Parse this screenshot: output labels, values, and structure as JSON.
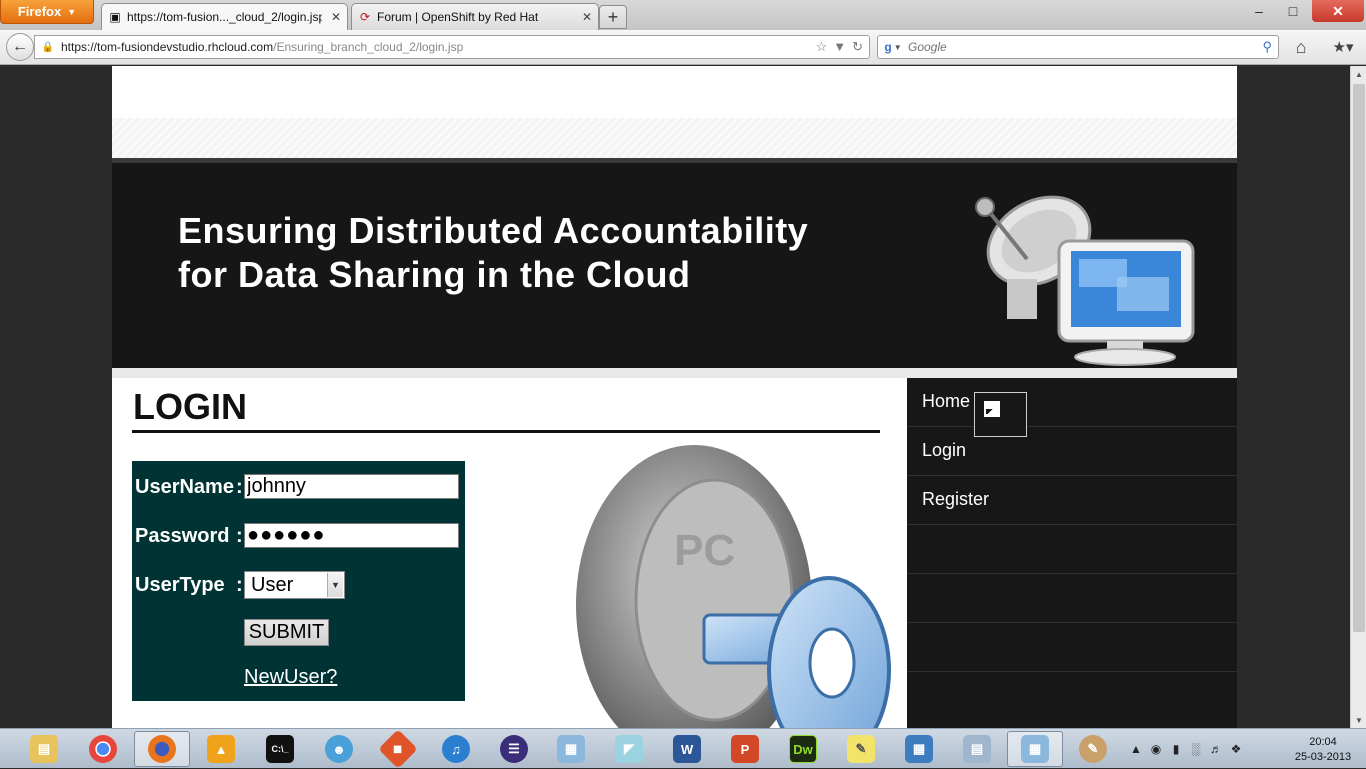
{
  "browser": {
    "menu_label": "Firefox",
    "tabs": [
      {
        "title": "https://tom-fusion..._cloud_2/login.jsp",
        "icon": "page-icon"
      },
      {
        "title": "Forum | OpenShift by Red Hat",
        "icon": "openshift-icon"
      }
    ],
    "url_host": "https://tom-fusiondevstudio.rhcloud.com",
    "url_path": "/Ensuring_branch_cloud_2/login.jsp",
    "search_placeholder": "Google",
    "controls": {
      "minimize": "‒",
      "maximize": "□",
      "close": "✕",
      "new_tab": "+",
      "tab_close": "✕"
    }
  },
  "site": {
    "title_line1": "Ensuring Distributed Accountability",
    "title_line2": "for Data Sharing in the Cloud"
  },
  "login": {
    "heading": "LOGIN",
    "username_label": "UserName",
    "password_label": "Password",
    "usertype_label": "UserType",
    "colon": ":",
    "username_value": "johnny",
    "password_mask": "●●●●●●",
    "usertype_value": "User",
    "submit_label": "SUBMIT",
    "newuser_label": "NewUser?"
  },
  "sidebar": {
    "items": [
      {
        "label": "Home"
      },
      {
        "label": "Login"
      },
      {
        "label": "Register"
      }
    ]
  },
  "taskbar": {
    "apps": [
      "explorer-icon",
      "chrome-icon",
      "firefox-icon",
      "vlc-icon",
      "cmd-icon",
      "chat-icon",
      "git-icon",
      "itunes-icon",
      "eclipse-icon",
      "virtualbox-icon",
      "paint-icon",
      "word-icon",
      "powerpoint-icon",
      "dreamweaver-icon",
      "notes-icon",
      "network-icon",
      "monitor-icon",
      "vbox-icon",
      "paint-brush-icon"
    ],
    "word_letter": "W",
    "ppt_letter": "P",
    "dw_letter": "Dw",
    "clock_time": "20:04",
    "clock_date": "25-03-2013"
  }
}
